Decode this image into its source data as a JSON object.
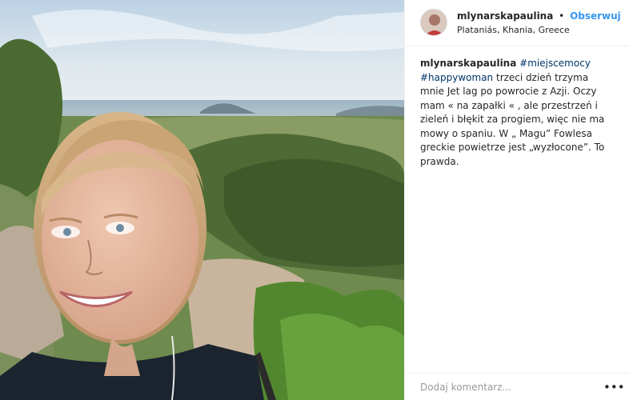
{
  "post": {
    "photo": {
      "subject": "selfie-photo"
    },
    "header": {
      "username": "mlynarskapaulina",
      "separator": "•",
      "follow_label": "Obserwuj",
      "location": "Plataniás, Khania, Greece",
      "avatar_icon": "avatar"
    },
    "caption": {
      "username": "mlynarskapaulina",
      "hashtag1": "#miejscemocy",
      "hashtag2": "#happywoman",
      "text": "trzeci dzień trzyma mnie Jet lag po powrocie z Azji. Oczy mam « na zapałki « , ale przestrzeń i zieleń i błękit za progiem, więc nie ma mowy o spaniu. W „ Magu” Fowlesa greckie powietrze jest „wyzłocone”. To prawda."
    },
    "comment": {
      "placeholder": "Dodaj komentarz...",
      "more_icon": "more-options-icon",
      "more_glyph": "•••"
    }
  },
  "colors": {
    "link": "#3897f0",
    "hashtag": "#003569",
    "text": "#262626",
    "border": "#efefef"
  }
}
